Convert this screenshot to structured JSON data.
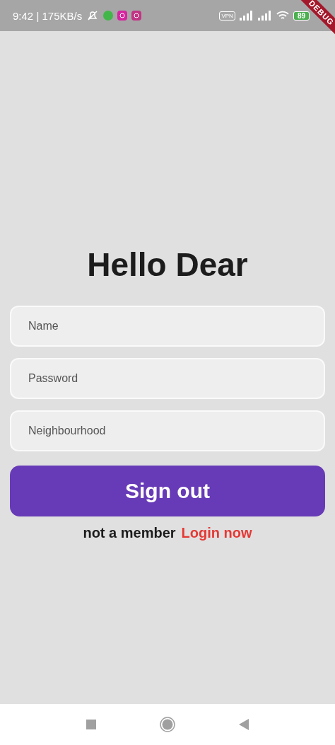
{
  "status_bar": {
    "time": "9:42",
    "separator": "|",
    "speed": "175KB/s",
    "vpn": "VPN",
    "battery": "89"
  },
  "debug_banner": "DEBUG",
  "title": "Hello Dear",
  "fields": [
    {
      "placeholder": "Name"
    },
    {
      "placeholder": "Password"
    },
    {
      "placeholder": "Neighbourhood"
    }
  ],
  "button": "Sign out",
  "footer": {
    "text": "not a member",
    "link": "Login now"
  }
}
